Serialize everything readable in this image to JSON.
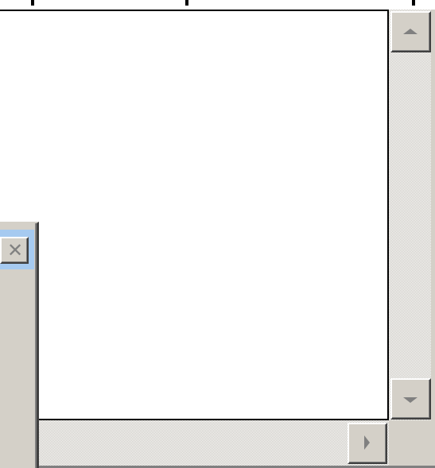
{
  "window": {
    "top_text": "",
    "content_text": ""
  },
  "scrollbars": {
    "vertical": {
      "up_icon": "arrow-up-icon",
      "down_icon": "arrow-down-icon"
    },
    "horizontal": {
      "right_icon": "arrow-right-icon"
    }
  },
  "dialog": {
    "close_icon": "close-icon",
    "close_glyph": "✕"
  },
  "colors": {
    "face": "#d4d0c8",
    "highlight": "#ffffff",
    "shadow": "#808080",
    "dark_shadow": "#404040",
    "active_title": "#a6caf0",
    "window": "#ffffff"
  }
}
